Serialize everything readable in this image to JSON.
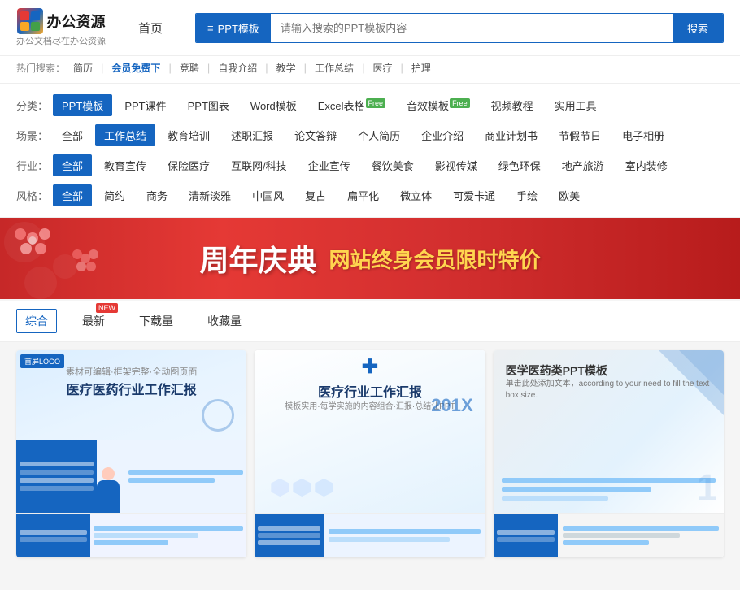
{
  "header": {
    "logo_icon": "办",
    "logo_text": "办公资源",
    "logo_sub": "办公文档尽在办公资源",
    "nav_home": "首页",
    "search_tab_icon": "≡",
    "search_tab_label": "PPT模板",
    "search_placeholder": "请输入搜索的PPT模板内容",
    "search_btn": "搜索"
  },
  "hot_search": {
    "label": "热门搜索：",
    "items": [
      "简历",
      "会员免费下",
      "竞聘",
      "自我介绍",
      "教学",
      "工作总结",
      "医疗",
      "护理"
    ]
  },
  "filter": {
    "category_label": "分类：",
    "categories": [
      {
        "label": "PPT模板",
        "active": true
      },
      {
        "label": "PPT课件",
        "active": false
      },
      {
        "label": "PPT图表",
        "active": false
      },
      {
        "label": "Word模板",
        "active": false
      },
      {
        "label": "Excel表格",
        "active": false,
        "badge": "Free"
      },
      {
        "label": "音效模板",
        "active": false,
        "badge": "Free"
      },
      {
        "label": "视频教程",
        "active": false
      },
      {
        "label": "实用工具",
        "active": false
      }
    ],
    "scene_label": "场景：",
    "scenes": [
      {
        "label": "全部",
        "active": false
      },
      {
        "label": "工作总结",
        "active": true
      },
      {
        "label": "教育培训",
        "active": false
      },
      {
        "label": "述职汇报",
        "active": false
      },
      {
        "label": "论文答辩",
        "active": false
      },
      {
        "label": "个人简历",
        "active": false
      },
      {
        "label": "企业介绍",
        "active": false
      },
      {
        "label": "商业计划书",
        "active": false
      },
      {
        "label": "节假节日",
        "active": false
      },
      {
        "label": "电子相册",
        "active": false
      }
    ],
    "industry_label": "行业：",
    "industries": [
      {
        "label": "全部",
        "active": true
      },
      {
        "label": "教育宣传",
        "active": false
      },
      {
        "label": "保险医疗",
        "active": false
      },
      {
        "label": "互联网/科技",
        "active": false
      },
      {
        "label": "企业宣传",
        "active": false
      },
      {
        "label": "餐饮美食",
        "active": false
      },
      {
        "label": "影视传媒",
        "active": false
      },
      {
        "label": "绿色环保",
        "active": false
      },
      {
        "label": "地产旅游",
        "active": false
      },
      {
        "label": "室内装修",
        "active": false
      }
    ],
    "style_label": "风格：",
    "styles": [
      {
        "label": "全部",
        "active": true
      },
      {
        "label": "简约",
        "active": false
      },
      {
        "label": "商务",
        "active": false
      },
      {
        "label": "清新淡雅",
        "active": false
      },
      {
        "label": "中国风",
        "active": false
      },
      {
        "label": "复古",
        "active": false
      },
      {
        "label": "扁平化",
        "active": false
      },
      {
        "label": "微立体",
        "active": false
      },
      {
        "label": "可爱卡通",
        "active": false
      },
      {
        "label": "手绘",
        "active": false
      },
      {
        "label": "欧美",
        "active": false
      }
    ]
  },
  "banner": {
    "main_text": "周年庆典",
    "sub_text": "网站终身会员限时特价"
  },
  "sort_bar": {
    "items": [
      {
        "label": "综合",
        "active": true,
        "badge": null
      },
      {
        "label": "最新",
        "active": false,
        "badge": "NEW"
      },
      {
        "label": "下载量",
        "active": false,
        "badge": null
      },
      {
        "label": "收藏量",
        "active": false,
        "badge": null
      }
    ]
  },
  "cards": [
    {
      "tag": "首屏LOGO",
      "title": "医疗医药行业工作汇报",
      "subtitle": "素材可编辑·框架完整·全动图页面",
      "year": "",
      "type": "medical-blue"
    },
    {
      "tag": "",
      "title": "医疗行业工作汇报",
      "subtitle": "模板实用·每学实施的内容组合·汇报·总结让PPT",
      "year": "201X",
      "type": "medical-white"
    },
    {
      "tag": "",
      "title": "医学医药类PPT模板",
      "subtitle": "单击此处添加文本，according to your need to fill the text box size.",
      "year": "",
      "type": "medical-gray"
    }
  ]
}
